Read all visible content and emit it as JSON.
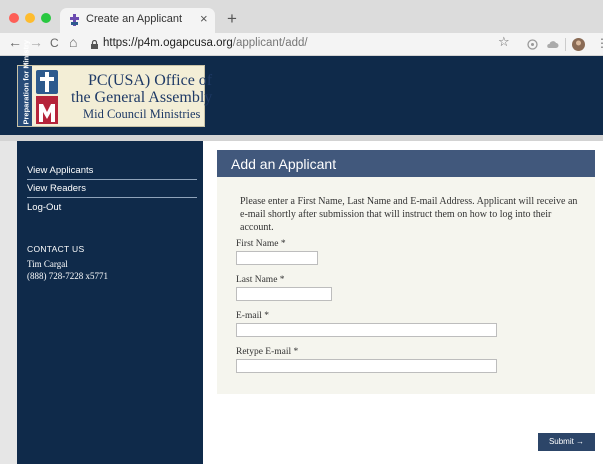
{
  "browser": {
    "tab_title": "Create an Applicant",
    "tab_close": "×",
    "new_tab": "+",
    "url_host": "https://p4m.ogapcusa.org",
    "url_path": "/applicant/add/",
    "nav": {
      "back": "←",
      "forward": "→",
      "reload": "C",
      "home": "⌂",
      "star": "☆"
    }
  },
  "logo": {
    "vertical_text": "Preparation for Ministry",
    "line1": "PC(USA) Office of",
    "line2": "the General Assembly",
    "line3": "Mid Council Ministries"
  },
  "sidebar": {
    "items": [
      {
        "label": "View Applicants"
      },
      {
        "label": "View Readers"
      },
      {
        "label": "Log-Out"
      }
    ],
    "contact_heading": "CONTACT US",
    "contact_name": "Tim Cargal",
    "contact_phone": "(888) 728-7228 x5771"
  },
  "main": {
    "title": "Add an Applicant",
    "intro": "Please enter a First Name, Last Name and E-mail Address. Applicant will receive an e-mail shortly after submission that will instruct them on how to log into their account.",
    "fields": {
      "first_name": {
        "label": "First Name *",
        "value": ""
      },
      "last_name": {
        "label": "Last Name *",
        "value": ""
      },
      "email": {
        "label": "E-mail *",
        "value": ""
      },
      "retype_email": {
        "label": "Retype E-mail *",
        "value": ""
      }
    },
    "submit_label": "Submit →"
  },
  "colors": {
    "header_bg": "#0f2a4a",
    "title_bar": "#41587c",
    "submit_bg": "#2c4568",
    "form_bg": "#f5f5ee"
  }
}
